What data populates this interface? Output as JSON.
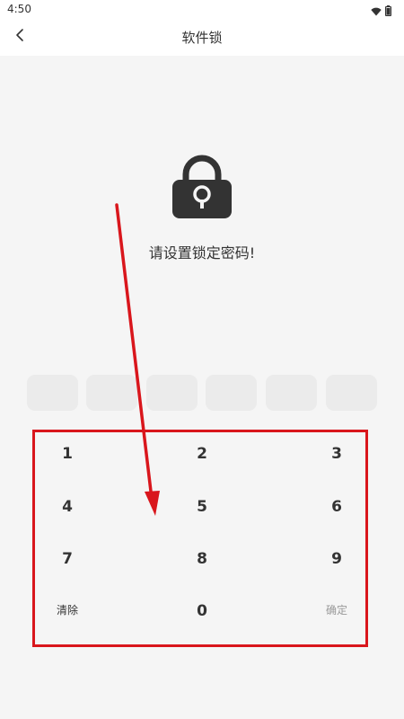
{
  "status_bar": {
    "time": "4:50",
    "icons": [
      "wifi-icon",
      "battery-icon"
    ]
  },
  "app_bar": {
    "title": "软件锁",
    "back_icon": "chevron-left-icon"
  },
  "lock": {
    "icon": "lock-icon",
    "prompt": "请设置锁定密码!"
  },
  "pin": {
    "length": 6,
    "filled": 0
  },
  "keypad": {
    "keys": [
      "1",
      "2",
      "3",
      "4",
      "5",
      "6",
      "7",
      "8",
      "9"
    ],
    "clear_label": "清除",
    "zero_label": "0",
    "confirm_label": "确定"
  },
  "annotation": {
    "color": "#d9161c"
  },
  "colors": {
    "background": "#f5f5f5",
    "text": "#333333",
    "muted": "#999999",
    "pin_box": "#ebebeb"
  }
}
